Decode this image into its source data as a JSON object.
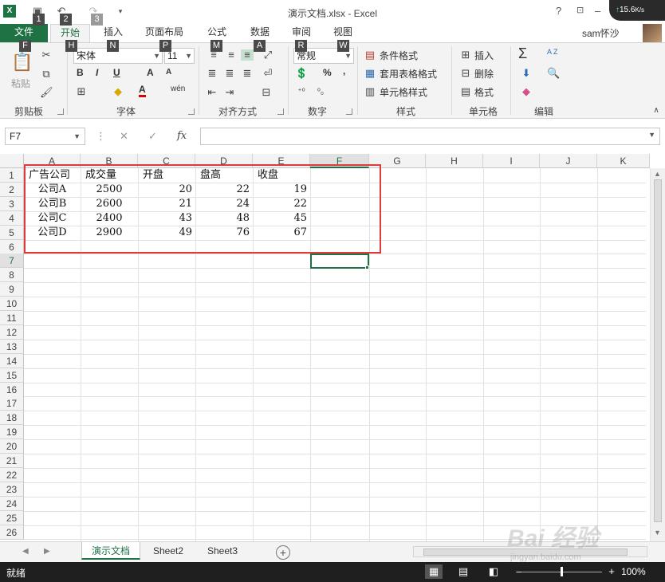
{
  "window": {
    "title": "演示文档.xlsx - Excel",
    "help": "?",
    "net_speed": "15.6",
    "net_unit": "K/s"
  },
  "qat": {
    "keytips": [
      "1",
      "2",
      "3"
    ]
  },
  "ribbon_tabs": [
    {
      "label": "文件",
      "keytip": "F"
    },
    {
      "label": "开始",
      "keytip": "H"
    },
    {
      "label": "插入",
      "keytip": "N"
    },
    {
      "label": "页面布局",
      "keytip": "P"
    },
    {
      "label": "公式",
      "keytip": "M"
    },
    {
      "label": "数据",
      "keytip": "A"
    },
    {
      "label": "审阅",
      "keytip": "R"
    },
    {
      "label": "视图",
      "keytip": "W"
    }
  ],
  "user": {
    "name": "sam怀沙"
  },
  "ribbon": {
    "clipboard": {
      "paste": "粘贴",
      "label": "剪贴板"
    },
    "font": {
      "name": "宋体",
      "size": "11",
      "label": "字体",
      "bold": "B",
      "italic": "I",
      "underline": "U",
      "grow": "A",
      "shrink": "A",
      "color_letter": "A",
      "phonetic": "wén"
    },
    "alignment": {
      "label": "对齐方式"
    },
    "number": {
      "format": "常规",
      "label": "数字",
      "percent": "%",
      "comma": ","
    },
    "styles": {
      "conditional": "条件格式",
      "table": "套用表格格式",
      "cell": "单元格样式",
      "label": "样式"
    },
    "cells": {
      "insert": "插入",
      "delete": "删除",
      "format": "格式",
      "label": "单元格"
    },
    "editing": {
      "label": "编辑",
      "sum": "Σ",
      "sort": "A Z"
    }
  },
  "formula_bar": {
    "name_box": "F7",
    "cancel": "✕",
    "enter": "✓",
    "fx": "fx",
    "content": ""
  },
  "sheet": {
    "columns": [
      "A",
      "B",
      "C",
      "D",
      "E",
      "F",
      "G",
      "H",
      "I",
      "J",
      "K"
    ],
    "rows": [
      "1",
      "2",
      "3",
      "4",
      "5",
      "6",
      "7",
      "8",
      "9",
      "10",
      "11",
      "12",
      "13",
      "14",
      "15",
      "16",
      "17",
      "18",
      "19",
      "20",
      "21",
      "22",
      "23",
      "24",
      "25",
      "26"
    ],
    "selected_cell": "F7",
    "headers": [
      "广告公司",
      "成交量",
      "开盘",
      "盘高",
      "收盘"
    ],
    "data": [
      [
        "公司A",
        "2500",
        "20",
        "22",
        "19"
      ],
      [
        "公司B",
        "2600",
        "21",
        "24",
        "22"
      ],
      [
        "公司C",
        "2400",
        "43",
        "48",
        "45"
      ],
      [
        "公司D",
        "2900",
        "49",
        "76",
        "67"
      ]
    ]
  },
  "sheet_tabs": [
    "演示文档",
    "Sheet2",
    "Sheet3"
  ],
  "status": {
    "text": "就绪",
    "zoom": "100%"
  },
  "colors": {
    "accent": "#1f7244",
    "highlight_box": "#e23a3a"
  }
}
